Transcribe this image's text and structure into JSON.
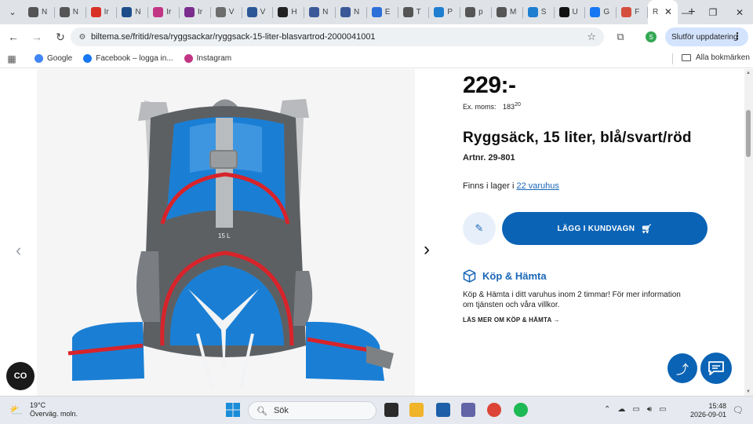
{
  "browser": {
    "tabs": [
      {
        "label": "N",
        "icon": "github-icon",
        "color": "#555555"
      },
      {
        "label": "N",
        "icon": "github-icon",
        "color": "#555555"
      },
      {
        "label": "Ir",
        "icon": "gmail-icon",
        "color": "#d93025"
      },
      {
        "label": "N",
        "icon": "news-icon",
        "color": "#1d4e89"
      },
      {
        "label": "Ir",
        "icon": "instagram-icon",
        "color": "#c13584"
      },
      {
        "label": "Ir",
        "icon": "page-icon",
        "color": "#7b2d8e"
      },
      {
        "label": "V",
        "icon": "doc-icon",
        "color": "#6d6d6d"
      },
      {
        "label": "V",
        "icon": "h-icon",
        "color": "#2b5797"
      },
      {
        "label": "H",
        "icon": "dash-icon",
        "color": "#222222"
      },
      {
        "label": "N",
        "icon": "wordpress-icon",
        "color": "#3b5998"
      },
      {
        "label": "N",
        "icon": "wordpress-icon",
        "color": "#3b5998"
      },
      {
        "label": "E",
        "icon": "edit-icon",
        "color": "#2e6fd8"
      },
      {
        "label": "T",
        "icon": "globe-icon",
        "color": "#555555"
      },
      {
        "label": "P",
        "icon": "p-icon",
        "color": "#1e7fd0"
      },
      {
        "label": "p",
        "icon": "search-icon",
        "color": "#555555"
      },
      {
        "label": "M",
        "icon": "globe-icon",
        "color": "#555555"
      },
      {
        "label": "S",
        "icon": "s-icon",
        "color": "#1e7fd0"
      },
      {
        "label": "U",
        "icon": "u-icon",
        "color": "#111111"
      },
      {
        "label": "G",
        "icon": "facebook-icon",
        "color": "#1877f2"
      },
      {
        "label": "F",
        "icon": "f-icon",
        "color": "#d54f3e"
      }
    ],
    "active_tab": {
      "label": "R",
      "close": "✕"
    },
    "new_tab": "+",
    "url": "biltema.se/fritid/resa/ryggsackar/ryggsack-15-liter-blasvartrod-2000041001",
    "profile_initial": "S",
    "update_label": "Slutför uppdatering",
    "bookmarks": [
      {
        "label": "Google",
        "icon": "google-icon",
        "color": "#4285f4"
      },
      {
        "label": "Facebook – logga in...",
        "icon": "facebook-icon",
        "color": "#1877f2"
      },
      {
        "label": "Instagram",
        "icon": "instagram-icon",
        "color": "#c13584"
      }
    ],
    "all_bookmarks": "Alla bokmärken"
  },
  "product": {
    "price": "229:-",
    "ex_moms_label": "Ex. moms:",
    "ex_moms_value": "183",
    "ex_moms_decimals": "20",
    "title": "Ryggsäck, 15 liter, blå/svart/röd",
    "artnr": "Artnr. 29-801",
    "stock_prefix": "Finns i lager i",
    "stock_link": "22 varuhus",
    "cart_button": "LÄGG I KUNDVAGN",
    "bag_label": "15 L"
  },
  "pickup": {
    "title": "Köp & Hämta",
    "text": "Köp & Hämta i ditt varuhus inom 2 timmar! För mer information om tjänsten och våra villkor.",
    "link": "LÄS MER OM KÖP & HÄMTA →"
  },
  "fab_dark_label": "CO",
  "taskbar": {
    "temp": "19°C",
    "weather": "Överväg. moln.",
    "search_placeholder": "Sök",
    "time": "15:48",
    "date": "2026-09-01"
  },
  "colors": {
    "accent_blue": "#0a63b5",
    "link_blue": "#1866b6",
    "bag_blue": "#1a7fd4",
    "bag_grey": "#5d6063",
    "bag_red": "#d8232a"
  }
}
